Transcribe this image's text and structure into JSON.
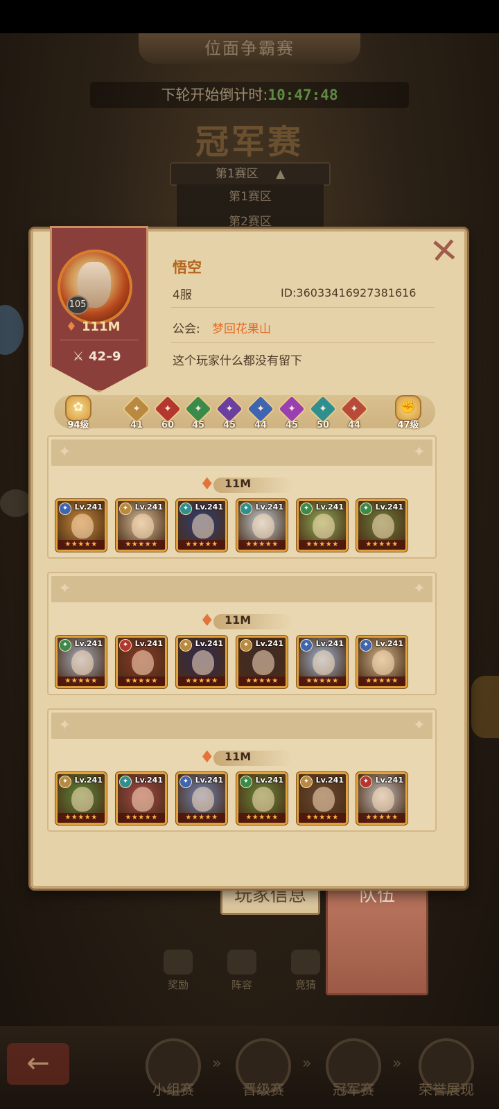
{
  "background": {
    "event_title": "位面争霸赛",
    "countdown_label": "下轮开始倒计时:",
    "countdown_time": "10:47:48",
    "stage_title": "冠军赛",
    "region_selected": "第1赛区",
    "region_options": [
      "第1赛区",
      "第2赛区"
    ],
    "tabs": {
      "player_info": "玩家信息",
      "team": "队伍"
    },
    "bottom_icons": [
      "奖励",
      "阵容",
      "竞猜"
    ],
    "stages": [
      "小组赛",
      "晋级赛",
      "冠军赛",
      "荣誉展现"
    ],
    "stage_arrow": "»"
  },
  "profile": {
    "level": "105",
    "power": "111M",
    "record": "42–9",
    "name": "悟空",
    "server": "4服",
    "id_text": "ID:36033416927381616",
    "guild_label": "公会:",
    "guild_name": "梦回花果山",
    "signature": "这个玩家什么都没有留下"
  },
  "faction_levels": {
    "left_total": "94级",
    "right_total": "47级",
    "factions": [
      {
        "icon": "light-bearer-icon",
        "value": "41",
        "color": "#b8893e"
      },
      {
        "icon": "mauler-icon",
        "value": "60",
        "color": "#b3372f"
      },
      {
        "icon": "wilder-icon",
        "value": "45",
        "color": "#3a8a4a"
      },
      {
        "icon": "graveborn-icon",
        "value": "45",
        "color": "#6a3fa0"
      },
      {
        "icon": "lightbringer-icon",
        "value": "44",
        "color": "#3f65b0"
      },
      {
        "icon": "celestial-icon",
        "value": "45",
        "color": "#9a3fb0"
      },
      {
        "icon": "hypogean-icon",
        "value": "50",
        "color": "#2f8f8f"
      },
      {
        "icon": "dimensional-icon",
        "value": "44",
        "color": "#b84a3a"
      }
    ]
  },
  "teams": [
    {
      "power": "11M",
      "heroes": [
        {
          "level": "Lv.241",
          "faction_color": "#3f65b0",
          "art": "#c98a3a"
        },
        {
          "level": "Lv.241",
          "faction_color": "#b8893e",
          "art": "#d9c29c"
        },
        {
          "level": "Lv.241",
          "faction_color": "#2f8f8f",
          "art": "#2c3f7a"
        },
        {
          "level": "Lv.241",
          "faction_color": "#2f8f8f",
          "art": "#c7d4dc"
        },
        {
          "level": "Lv.241",
          "faction_color": "#3a8a4a",
          "art": "#8fae58"
        },
        {
          "level": "Lv.241",
          "faction_color": "#3a8a4a",
          "art": "#6e7f3a"
        }
      ]
    },
    {
      "power": "11M",
      "heroes": [
        {
          "level": "Lv.241",
          "faction_color": "#3a8a4a",
          "art": "#a7b0c2"
        },
        {
          "level": "Lv.241",
          "faction_color": "#b3372f",
          "art": "#8b3a2a"
        },
        {
          "level": "Lv.241",
          "faction_color": "#b8893e",
          "art": "#2b2a56"
        },
        {
          "level": "Lv.241",
          "faction_color": "#b8893e",
          "art": "#3b2a2a"
        },
        {
          "level": "Lv.241",
          "faction_color": "#3f65b0",
          "art": "#9fb6d6"
        },
        {
          "level": "Lv.241",
          "faction_color": "#3f65b0",
          "art": "#d2b68c"
        }
      ]
    },
    {
      "power": "11M",
      "heroes": [
        {
          "level": "Lv.241",
          "faction_color": "#b8893e",
          "art": "#5f8a3a"
        },
        {
          "level": "Lv.241",
          "faction_color": "#2f8f8f",
          "art": "#a44a4a"
        },
        {
          "level": "Lv.241",
          "faction_color": "#3f65b0",
          "art": "#6f86b8"
        },
        {
          "level": "Lv.241",
          "faction_color": "#3a8a4a",
          "art": "#6a8a3a"
        },
        {
          "level": "Lv.241",
          "faction_color": "#b8893e",
          "art": "#6a4a30"
        },
        {
          "level": "Lv.241",
          "faction_color": "#b3372f",
          "art": "#c9c4c0"
        }
      ]
    }
  ]
}
